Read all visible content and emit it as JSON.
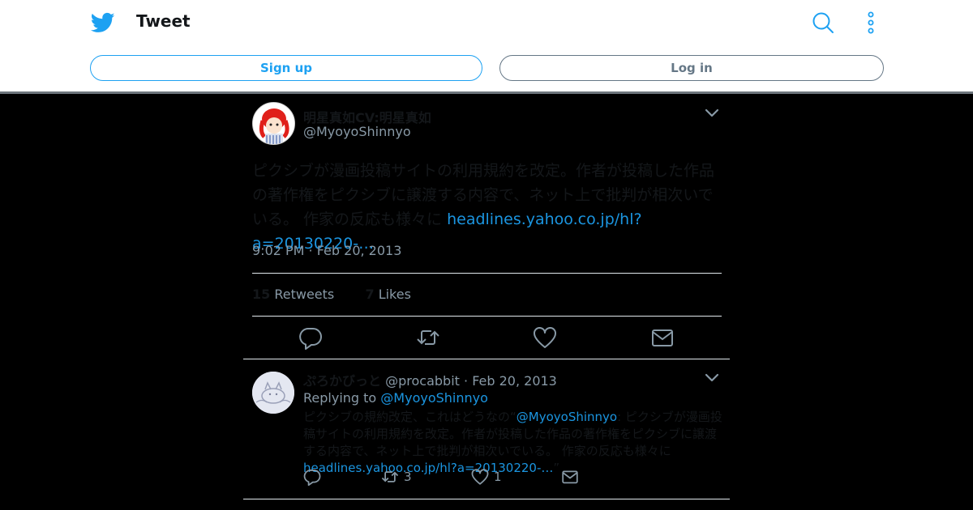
{
  "header": {
    "title": "Tweet",
    "signup_label": "Sign up",
    "login_label": "Log in"
  },
  "tweet": {
    "display_name": "明星真如CV:明星真如",
    "handle": "@MyoyoShinnyo",
    "text": "ピクシブが漫画投稿サイトの利用規約を改定。作者が投稿した作品の著作権をピクシブに譲渡する内容で、ネット上で批判が相次いでいる。 作家の反応も様々に ",
    "link": "headlines.yahoo.co.jp/hl?a=20130220-…",
    "timestamp": "9:02 PM · Feb 20, 2013",
    "retweets_count": "15",
    "retweets_label": "Retweets",
    "likes_count": "7",
    "likes_label": "Likes"
  },
  "reply": {
    "display_name": "ぷろかびっと",
    "handle": "@procabbit",
    "date": "· Feb 20, 2013",
    "replying_label": "Replying to",
    "replying_to": "@MyoyoShinnyo",
    "quote_open": "ピクシブの規約改定、これはどうなの“",
    "mention": "@MyoyoShinnyo",
    "text": ": ピクシブが漫画投稿サイトの利用規約を改定。作者が投稿した作品の著作権をピクシブに譲渡する内容で、ネット上で批判が相次いでいる。 作家の反応も様々に ",
    "link": "headlines.yahoo.co.jp/hl?a=20130220-…",
    "quote_close": "”",
    "retweets": "3",
    "likes": "1"
  },
  "colors": {
    "accent": "#1da1f2",
    "link": "#1b95e0",
    "muted": "#8899a6"
  },
  "icons": [
    "twitter-bird-icon",
    "search-icon",
    "more-vertical-icon",
    "chevron-down-icon",
    "reply-icon",
    "retweet-icon",
    "like-icon",
    "share-mail-icon"
  ]
}
